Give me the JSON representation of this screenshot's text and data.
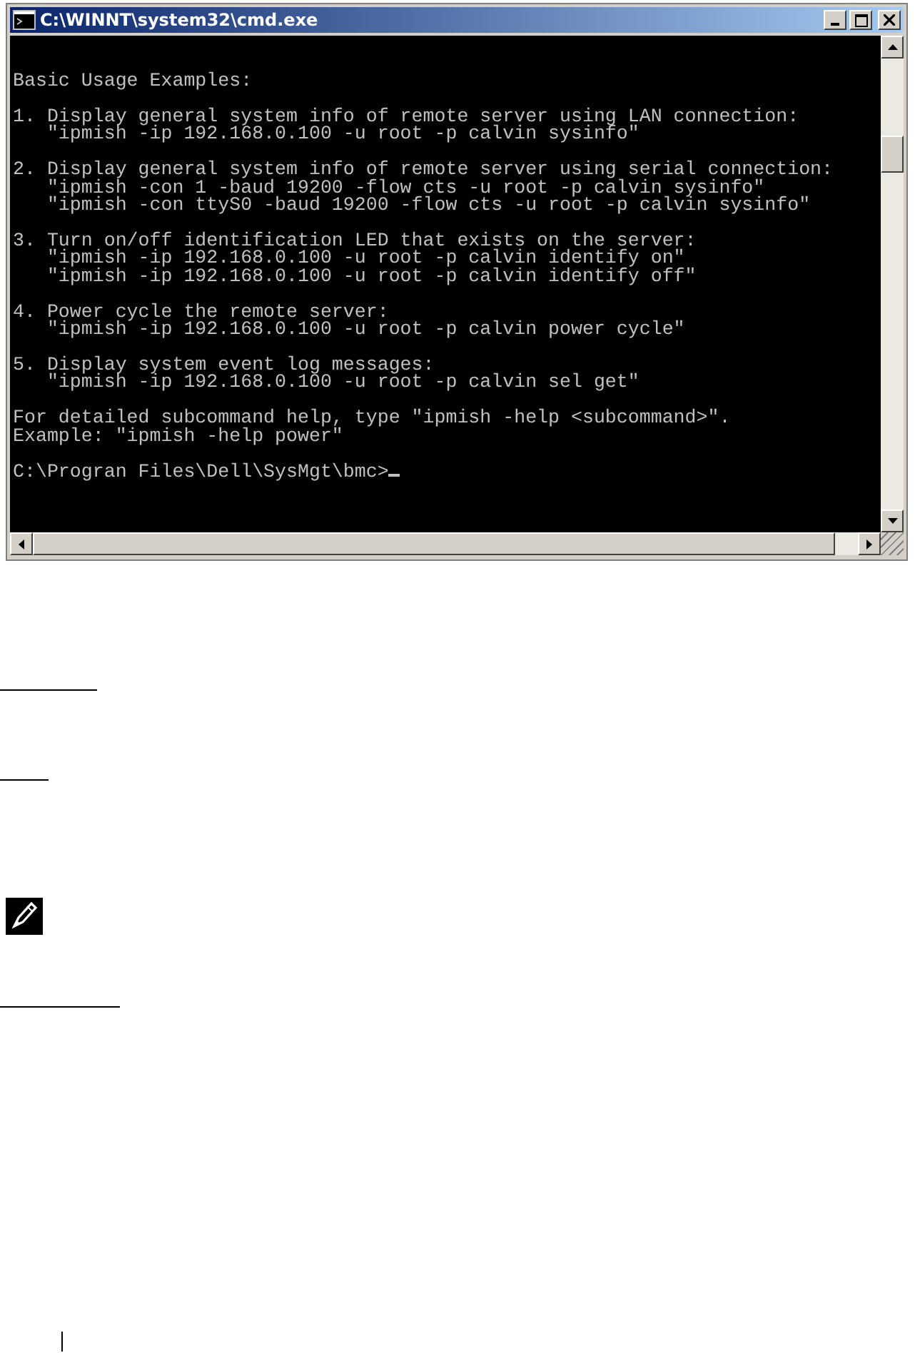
{
  "window": {
    "title": "C:\\WINNT\\system32\\cmd.exe"
  },
  "console": {
    "blocks": [
      {
        "lines": [
          "Basic Usage Examples:"
        ]
      },
      {
        "lines": [
          "1. Display general system info of remote server using LAN connection:",
          "   \"ipmish -ip 192.168.0.100 -u root -p calvin sysinfo\""
        ]
      },
      {
        "lines": [
          "2. Display general system info of remote server using serial connection:",
          "   \"ipmish -con 1 -baud 19200 -flow cts -u root -p calvin sysinfo\"",
          "   \"ipmish -con ttyS0 -baud 19200 -flow cts -u root -p calvin sysinfo\""
        ]
      },
      {
        "lines": [
          "3. Turn on/off identification LED that exists on the server:",
          "   \"ipmish -ip 192.168.0.100 -u root -p calvin identify on\"",
          "   \"ipmish -ip 192.168.0.100 -u root -p calvin identify off\""
        ]
      },
      {
        "lines": [
          "4. Power cycle the remote server:",
          "   \"ipmish -ip 192.168.0.100 -u root -p calvin power cycle\""
        ]
      },
      {
        "lines": [
          "5. Display system event log messages:",
          "   \"ipmish -ip 192.168.0.100 -u root -p calvin sel get\""
        ]
      },
      {
        "lines": [
          "For detailed subcommand help, type \"ipmish -help <subcommand>\".",
          "Example: \"ipmish -help power\""
        ]
      },
      {
        "lines": [
          "C:\\Progran Files\\Dell\\SysMgt\\bmc>"
        ]
      }
    ]
  }
}
